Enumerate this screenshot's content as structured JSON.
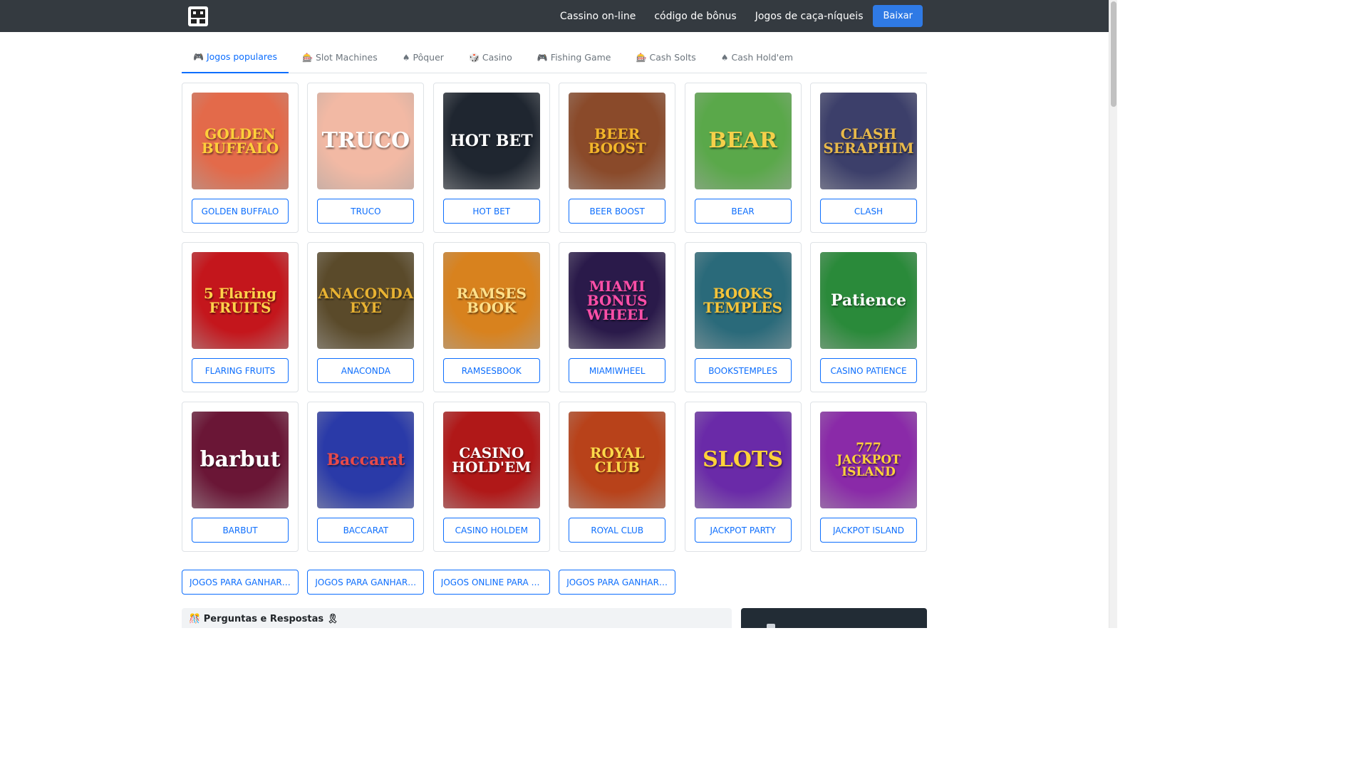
{
  "navbar": {
    "links": [
      "Cassino on-line",
      "código de bônus",
      "Jogos de caça-níqueis"
    ],
    "download_label": "Baixar"
  },
  "tabs": [
    {
      "icon": "🎮",
      "label": "Jogos populares",
      "active": true
    },
    {
      "icon": "🎰",
      "label": "Slot Machines",
      "active": false
    },
    {
      "icon": "♠",
      "label": "Pôquer",
      "active": false
    },
    {
      "icon": "🎲",
      "label": "Casino",
      "active": false
    },
    {
      "icon": "🎮",
      "label": "Fishing Game",
      "active": false
    },
    {
      "icon": "🎰",
      "label": "Cash Solts",
      "active": false
    },
    {
      "icon": "♠",
      "label": "Cash Hold'em",
      "active": false
    }
  ],
  "games": [
    {
      "name": "GOLDEN BUFFALO",
      "art": "GOLDEN\nBUFFALO",
      "bg": "#e36a4a",
      "fg": "#ffcf3a"
    },
    {
      "name": "TRUCO",
      "art": "TRUCO",
      "bg": "#f2b9a4",
      "fg": "#ffffff"
    },
    {
      "name": "HOT BET",
      "art": "HOT BET",
      "bg": "#1f2630",
      "fg": "#ffffff"
    },
    {
      "name": "BEER BOOST",
      "art": "BEER\nBOOST",
      "bg": "#8a4a2a",
      "fg": "#f3b52a"
    },
    {
      "name": "BEAR",
      "art": "BEAR",
      "bg": "#5aa84a",
      "fg": "#f5d04a"
    },
    {
      "name": "CLASH",
      "art": "CLASH\nSERAPHIM",
      "bg": "#3c3f6a",
      "fg": "#e8b94a"
    },
    {
      "name": "FLARING FRUITS",
      "art": "5 Flaring\nFRUITS",
      "bg": "#c4161c",
      "fg": "#ffd24a"
    },
    {
      "name": "ANACONDA",
      "art": "ANACONDA\nEYE",
      "bg": "#5a4a2a",
      "fg": "#e8b232"
    },
    {
      "name": "RAMSESBOOK",
      "art": "RAMSES\nBOOK",
      "bg": "#d8821e",
      "fg": "#ffe08a"
    },
    {
      "name": "MIAMIWHEEL",
      "art": "MIAMI\nBONUS WHEEL",
      "bg": "#2a1a4a",
      "fg": "#ff4fa8"
    },
    {
      "name": "BOOKSTEMPLES",
      "art": "BOOKS\nTEMPLES",
      "bg": "#2a6a7a",
      "fg": "#f5c43a"
    },
    {
      "name": "CASINO PATIENCE",
      "art": "Patience",
      "bg": "#2a8a3a",
      "fg": "#ffffff"
    },
    {
      "name": "BARBUT",
      "art": "barbut",
      "bg": "#6a1636",
      "fg": "#ffffff"
    },
    {
      "name": "BACCARAT",
      "art": "Baccarat",
      "bg": "#2a3aa8",
      "fg": "#e84a4a"
    },
    {
      "name": "CASINO HOLDEM",
      "art": "CASINO\nHOLD'EM",
      "bg": "#b01818",
      "fg": "#ffffff"
    },
    {
      "name": "ROYAL CLUB",
      "art": "ROYAL\nCLUB",
      "bg": "#b8421a",
      "fg": "#ffd84a"
    },
    {
      "name": "JACKPOT PARTY",
      "art": "SLOTS",
      "bg": "#6a2aa8",
      "fg": "#ffd23a"
    },
    {
      "name": "JACKPOT ISLAND",
      "art": "777\nJACKPOT\nISLAND",
      "bg": "#8a2aa8",
      "fg": "#ffd23a"
    }
  ],
  "bottom_links": [
    "JOGOS PARA GANHAR DINHEIRO",
    "JOGOS PARA GANHAR DINHEIRO",
    "JOGOS ONLINE PARA GANHAR DINHEIRO",
    "JOGOS PARA GANHAR DINHEIRO"
  ],
  "faq": {
    "icon_left": "🎊",
    "title": "Perguntas e Respostas",
    "icon_right": "🎗"
  }
}
